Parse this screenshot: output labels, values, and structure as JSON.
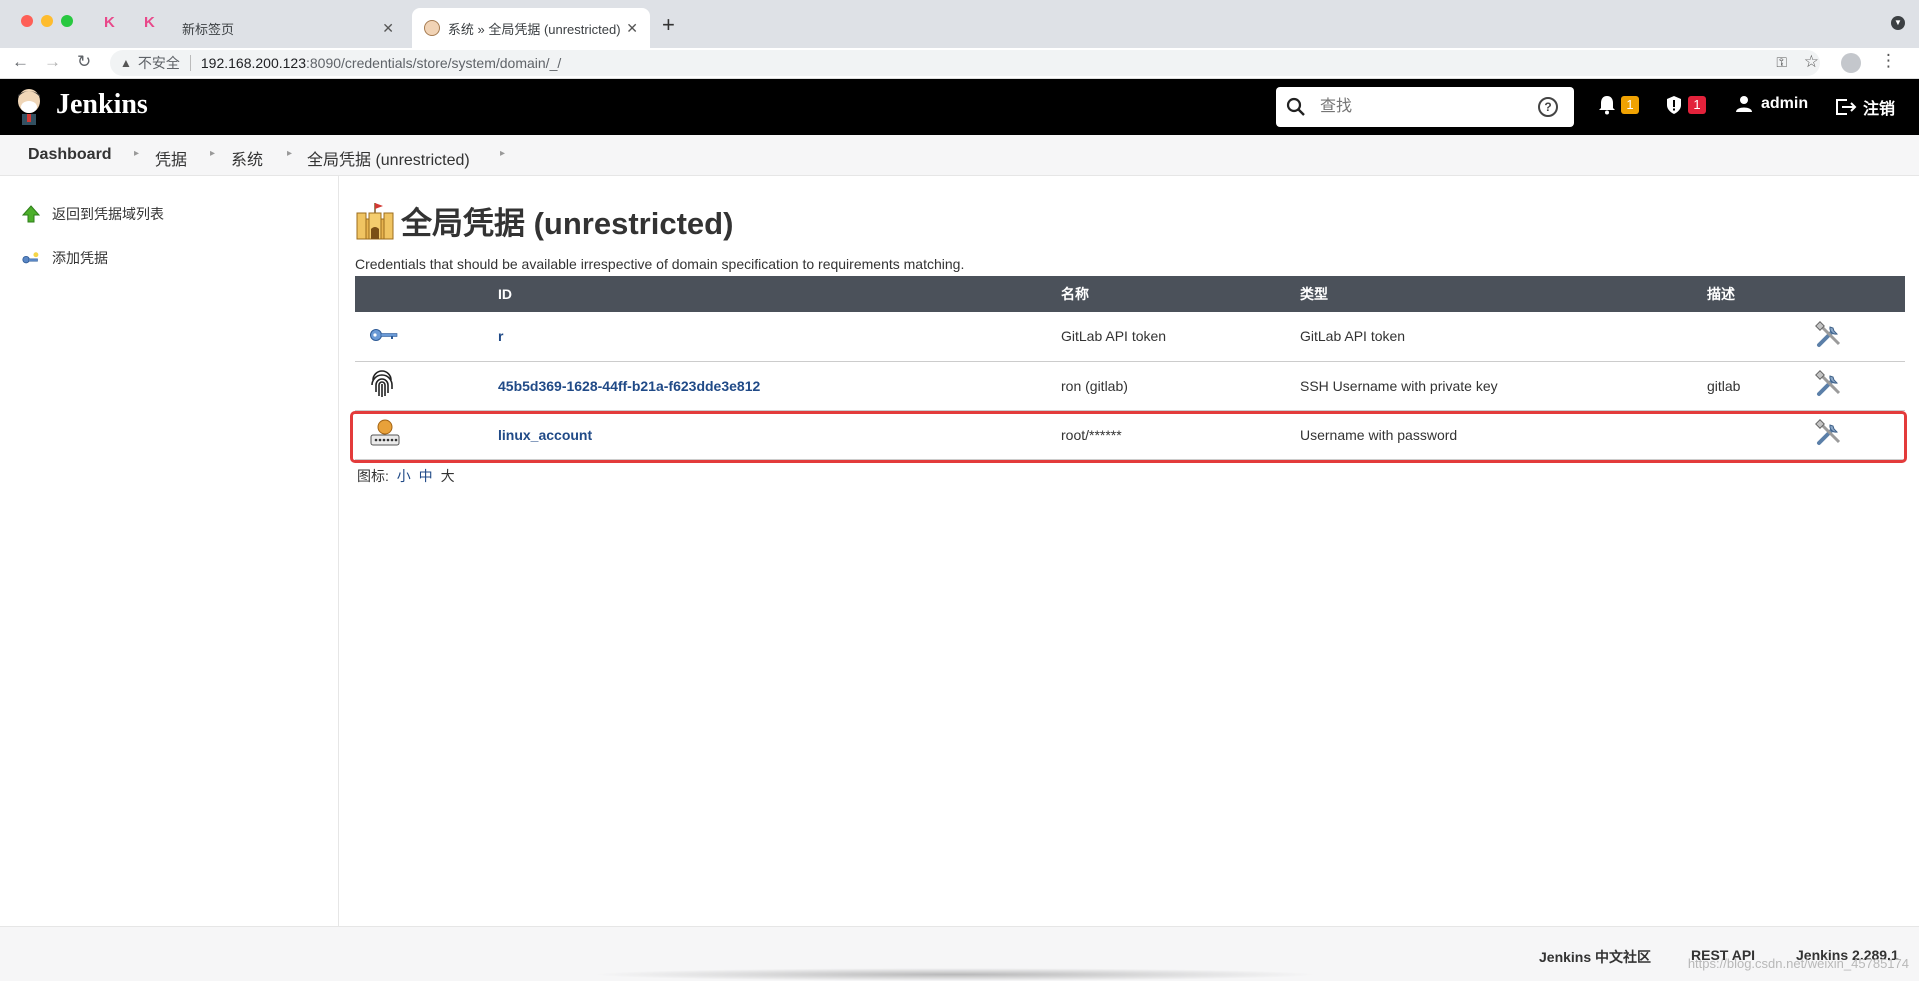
{
  "browser": {
    "inactive_tab_title": "新标签页",
    "active_tab_title": "系统 » 全局凭据 (unrestricted)",
    "insecure_label": "不安全",
    "url_host": "192.168.200.123",
    "url_path": ":8090/credentials/store/system/domain/_/"
  },
  "header": {
    "title": "Jenkins",
    "search_placeholder": "查找",
    "notifications_count": "1",
    "security_count": "1",
    "user": "admin",
    "logout": "注销",
    "colors": {
      "bar": "#000000",
      "notif_badge": "#f0a202",
      "security_badge": "#e3223b"
    }
  },
  "breadcrumb": [
    "Dashboard",
    "凭据",
    "系统",
    "全局凭据 (unrestricted)"
  ],
  "sidebar": {
    "items": [
      {
        "label": "返回到凭据域列表",
        "icon": "up-arrow-icon"
      },
      {
        "label": "添加凭据",
        "icon": "add-key-icon"
      }
    ]
  },
  "main": {
    "title": "全局凭据 (unrestricted)",
    "description": "Credentials that should be available irrespective of domain specification to requirements matching.",
    "columns": {
      "id": "ID",
      "name": "名称",
      "kind": "类型",
      "description": "描述"
    },
    "rows": [
      {
        "icon": "key-icon",
        "id": "r",
        "name": "GitLab API token",
        "kind": "GitLab API token",
        "description": ""
      },
      {
        "icon": "fingerprint-icon",
        "id": "45b5d369-1628-44ff-b21a-f623dde3e812",
        "name": "ron (gitlab)",
        "kind": "SSH Username with private key",
        "description": "gitlab"
      },
      {
        "icon": "user-password-icon",
        "id": "linux_account",
        "name": "root/******",
        "kind": "Username with password",
        "description": ""
      }
    ],
    "icon_size_label": "图标:",
    "icon_sizes": [
      "小",
      "中",
      "大"
    ],
    "highlight_color": "#e33b3b"
  },
  "footer": {
    "community": "Jenkins 中文社区",
    "rest_api": "REST API",
    "version": "Jenkins 2.289.1",
    "watermark": "https://blog.csdn.net/weixin_45785174"
  }
}
